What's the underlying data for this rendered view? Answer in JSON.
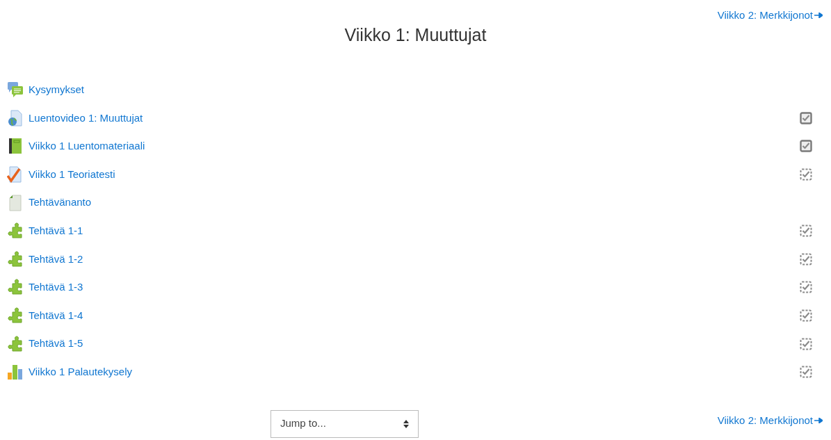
{
  "next_link_top": "Viikko 2: Merkkijonot",
  "title": "Viikko 1: Muuttujat",
  "activities": [
    {
      "kind": "forum",
      "label": "Kysymykset",
      "tracked": false
    },
    {
      "kind": "url",
      "label": "Luentovideo 1: Muuttujat",
      "tracked": true,
      "manual": true
    },
    {
      "kind": "book",
      "label": "Viikko 1 Luentomateriaali",
      "tracked": true,
      "manual": true
    },
    {
      "kind": "quiz",
      "label": "Viikko 1 Teoriatesti",
      "tracked": true,
      "manual": false
    },
    {
      "kind": "resource",
      "label": "Tehtävänanto",
      "tracked": false
    },
    {
      "kind": "puzzle",
      "label": "Tehtävä 1-1",
      "tracked": true,
      "manual": false
    },
    {
      "kind": "puzzle",
      "label": "Tehtävä 1-2",
      "tracked": true,
      "manual": false
    },
    {
      "kind": "puzzle",
      "label": "Tehtävä 1-3",
      "tracked": true,
      "manual": false
    },
    {
      "kind": "puzzle",
      "label": "Tehtävä 1-4",
      "tracked": true,
      "manual": false
    },
    {
      "kind": "puzzle",
      "label": "Tehtävä 1-5",
      "tracked": true,
      "manual": false
    },
    {
      "kind": "feedback",
      "label": "Viikko 1 Palautekysely",
      "tracked": true,
      "manual": false
    }
  ],
  "jump_select": {
    "value": "Jump to..."
  },
  "next_link_bottom": "Viikko 2: Merkkijonot"
}
